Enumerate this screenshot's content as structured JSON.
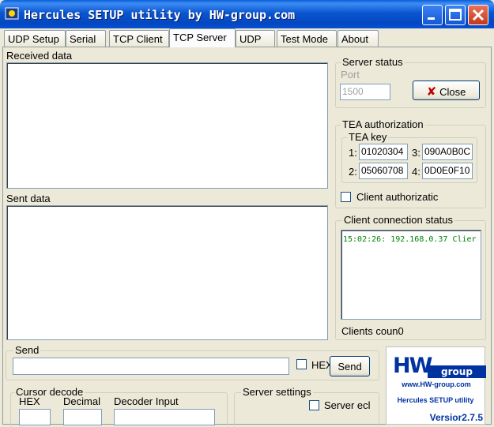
{
  "window": {
    "title": "Hercules SETUP utility by HW-group.com"
  },
  "tabs": [
    "UDP Setup",
    "Serial",
    "TCP Client",
    "TCP Server",
    "UDP",
    "Test Mode",
    "About"
  ],
  "active_tab": "TCP Server",
  "received": {
    "label": "Received data"
  },
  "sent": {
    "label": "Sent data"
  },
  "server_status": {
    "title": "Server status",
    "port_label": "Port",
    "port_value": "1500",
    "close_label": "Close"
  },
  "tea": {
    "title": "TEA authorization",
    "key_title": "TEA key",
    "keys": [
      {
        "num": "1:",
        "value": "01020304"
      },
      {
        "num": "2:",
        "value": "05060708"
      },
      {
        "num": "3:",
        "value": "090A0B0C"
      },
      {
        "num": "4:",
        "value": "0D0E0F10"
      }
    ],
    "client_auth_label": "Client authorizatic"
  },
  "client_status": {
    "title": "Client connection status",
    "log": "15:02:26:  192.168.0.37 Clier",
    "count_label": "Clients coun0"
  },
  "send": {
    "title": "Send",
    "hex_label": "HEX",
    "button": "Send"
  },
  "cursor_decode": {
    "title": "Cursor decode",
    "hex": "HEX",
    "decimal": "Decimal",
    "decoder_input": "Decoder Input"
  },
  "server_settings": {
    "title": "Server settings",
    "echo_label": "Server ecl"
  },
  "logo": {
    "brand_hw": "HW",
    "brand_group": "group",
    "url": "www.HW-group.com",
    "product": "Hercules SETUP utility",
    "version": "Versior2.7.5"
  },
  "colors": {
    "titlebar": "#0a56d0",
    "log_text": "#008000",
    "logo_blue": "#0033a0",
    "close_x": "#c00000"
  }
}
